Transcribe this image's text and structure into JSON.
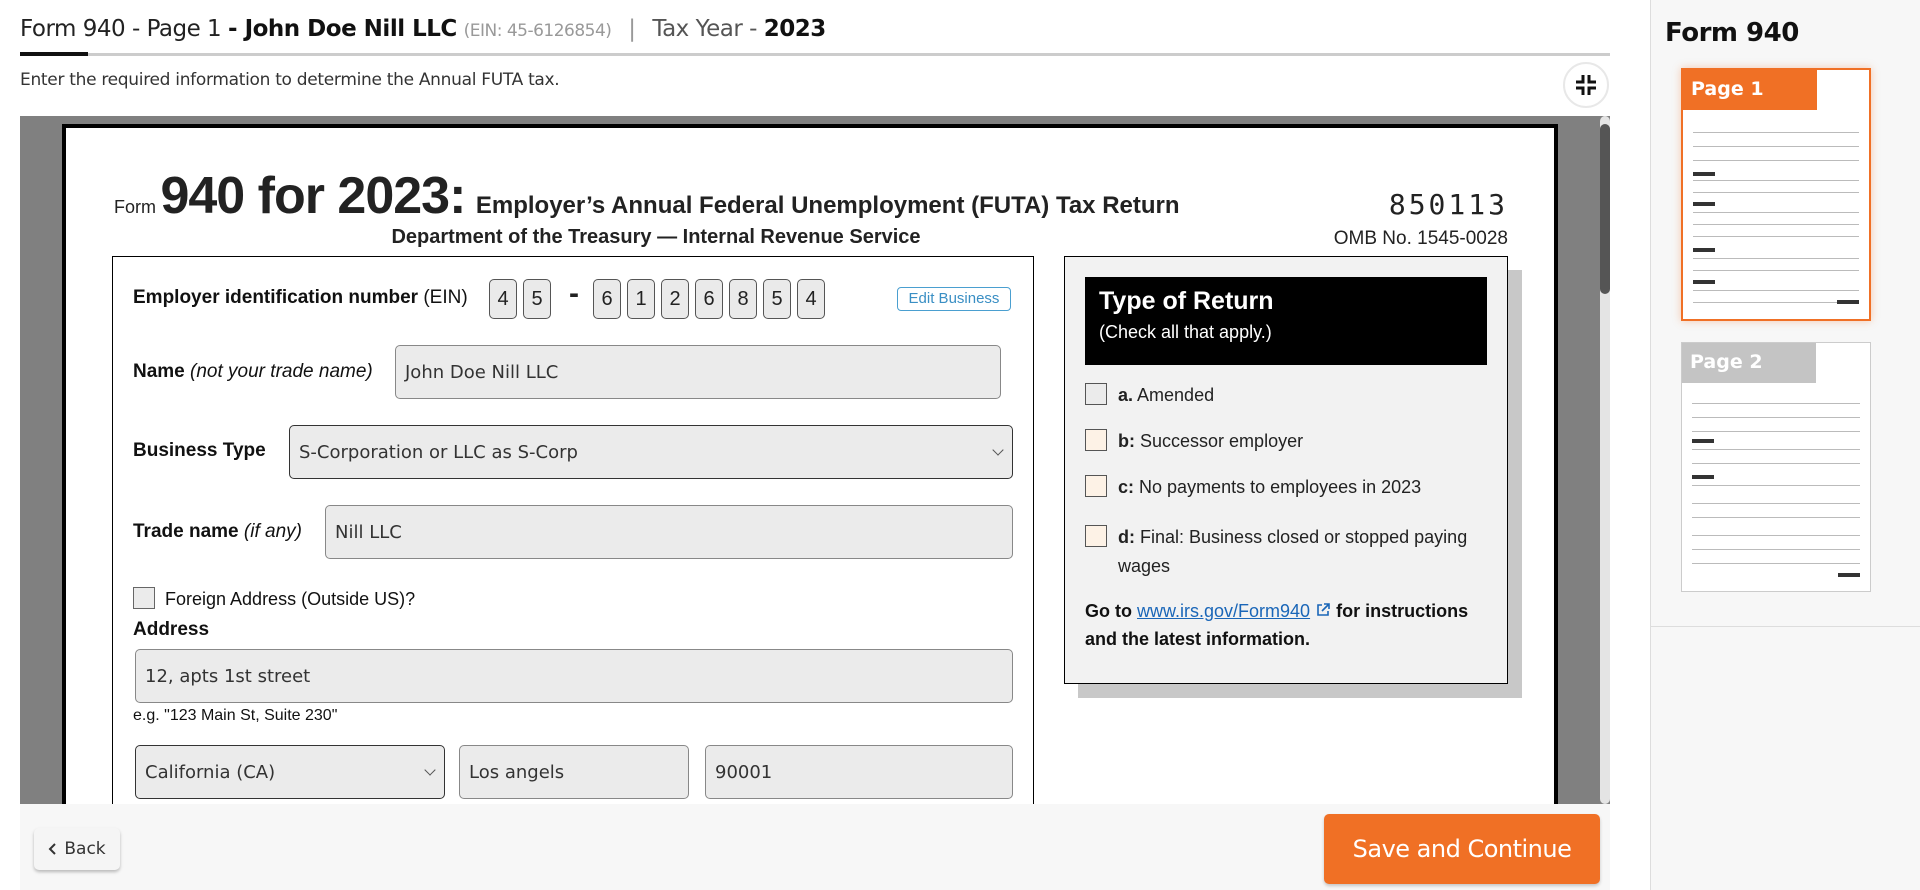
{
  "header": {
    "form_label": "Form 940 - Page 1",
    "business_name": "- John Doe Nill LLC",
    "ein_text": "(EIN: 45-6126854)",
    "separator": "|",
    "tax_year_label": "Tax Year -",
    "tax_year": "2023",
    "subtitle": "Enter the required information to determine the Annual FUTA tax."
  },
  "form": {
    "form_word": "Form",
    "form_number": "940 for 2023:",
    "form_title": "Employer’s Annual Federal Unemployment (FUTA) Tax Return",
    "department": "Department of the Treasury — Internal Revenue Service",
    "barcode": "850113",
    "omb": "OMB No. 1545-0028",
    "ein": {
      "label_bold": "Employer identification number",
      "label_rest": "(EIN)",
      "digits_prefix": [
        "4",
        "5"
      ],
      "dash": "-",
      "digits_suffix": [
        "6",
        "1",
        "2",
        "6",
        "8",
        "5",
        "4"
      ],
      "edit_button": "Edit Business"
    },
    "name": {
      "label_bold": "Name",
      "label_italic": "(not your trade name)",
      "value": "John Doe Nill LLC"
    },
    "business_type": {
      "label": "Business Type",
      "value": "S-Corporation or LLC as S-Corp"
    },
    "trade_name": {
      "label_bold": "Trade name",
      "label_italic": "(if any)",
      "value": "Nill LLC"
    },
    "foreign_address": {
      "label": "Foreign Address (Outside US)?",
      "checked": false
    },
    "address": {
      "label": "Address",
      "value": "12, apts 1st street",
      "hint": "e.g. \"123 Main St, Suite 230\""
    },
    "state": {
      "value": "California (CA)"
    },
    "city": {
      "value": "Los angels"
    },
    "zip": {
      "value": "90001"
    }
  },
  "type_of_return": {
    "title": "Type of Return",
    "subtitle": "(Check all that apply.)",
    "items": [
      {
        "key": "a.",
        "label": "Amended",
        "checked": false
      },
      {
        "key": "b:",
        "label": "Successor employer",
        "checked": false
      },
      {
        "key": "c:",
        "label": "No payments to employees in 2023",
        "checked": false
      },
      {
        "key": "d:",
        "label": "Final: Business closed or stopped paying wages",
        "checked": false
      }
    ],
    "note_prefix": "Go to",
    "note_link": "www.irs.gov/Form940",
    "note_suffix": "for instructions and the latest information."
  },
  "footer": {
    "back_label": "Back",
    "save_label": "Save and Continue"
  },
  "sidebar": {
    "title": "Form 940",
    "pages": [
      {
        "label": "Page 1",
        "active": true
      },
      {
        "label": "Page 2",
        "active": false
      }
    ]
  },
  "colors": {
    "accent": "#f07025",
    "link": "#1a66b8",
    "edit_button": "#3a8fc4"
  }
}
